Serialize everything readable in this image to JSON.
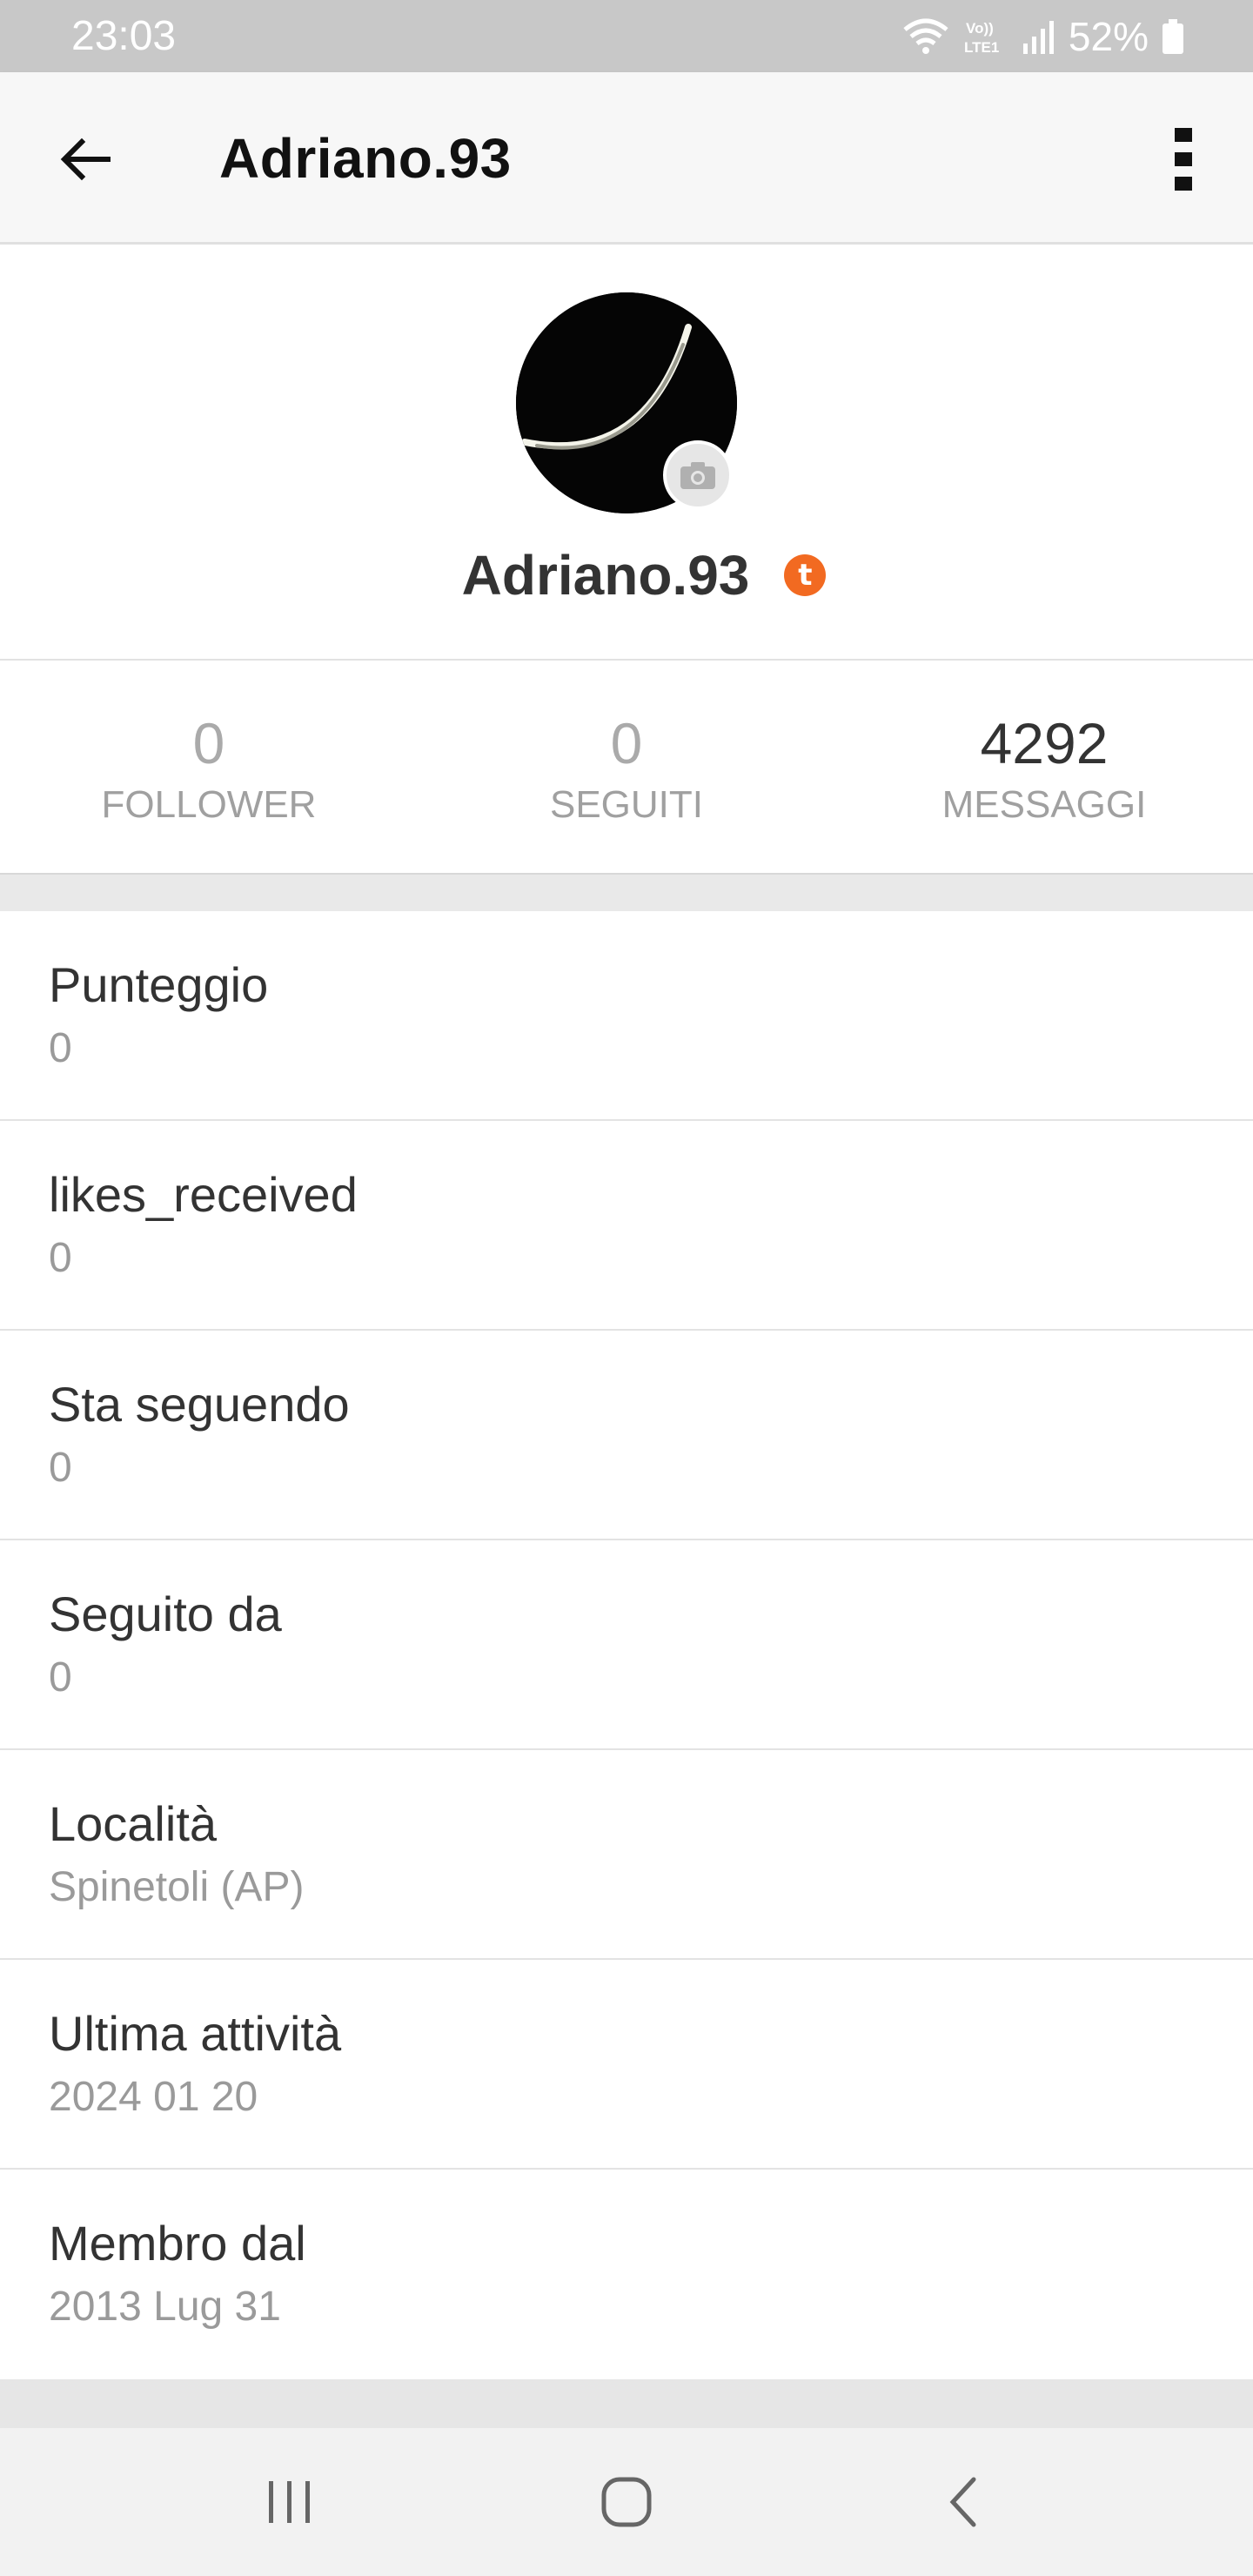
{
  "status_bar": {
    "time": "23:03",
    "battery_percent": "52%",
    "network_label": "Vo)) LTE1",
    "icons": [
      "wifi-icon",
      "signal-icon",
      "battery-icon"
    ]
  },
  "app_bar": {
    "title": "Adriano.93",
    "back_icon": "arrow-left-icon",
    "more_icon": "more-vert-icon"
  },
  "profile": {
    "name": "Adriano.93",
    "badge_letter": "t",
    "avatar_icon": "crescent-moon-avatar",
    "camera_icon": "camera-icon"
  },
  "stats": [
    {
      "value": "0",
      "label": "FOLLOWER"
    },
    {
      "value": "0",
      "label": "SEGUITI"
    },
    {
      "value": "4292",
      "label": "MESSAGGI"
    }
  ],
  "info": [
    {
      "label": "Punteggio",
      "value": "0"
    },
    {
      "label": "likes_received",
      "value": "0"
    },
    {
      "label": "Sta seguendo",
      "value": "0"
    },
    {
      "label": "Seguito da",
      "value": "0"
    },
    {
      "label": "Località",
      "value": "Spinetoli (AP)"
    },
    {
      "label": "Ultima attività",
      "value": "2024 01 20"
    },
    {
      "label": "Membro dal",
      "value": "2013 Lug 31"
    }
  ],
  "nav_bar": {
    "icons": [
      "recent-apps-icon",
      "home-icon",
      "back-icon"
    ]
  },
  "colors": {
    "status_bar_bg": "#c8c8c8",
    "app_bar_bg": "#f7f7f7",
    "badge_orange": "#f26a21",
    "muted_text": "#9a9a9a",
    "primary_text": "#333333"
  }
}
